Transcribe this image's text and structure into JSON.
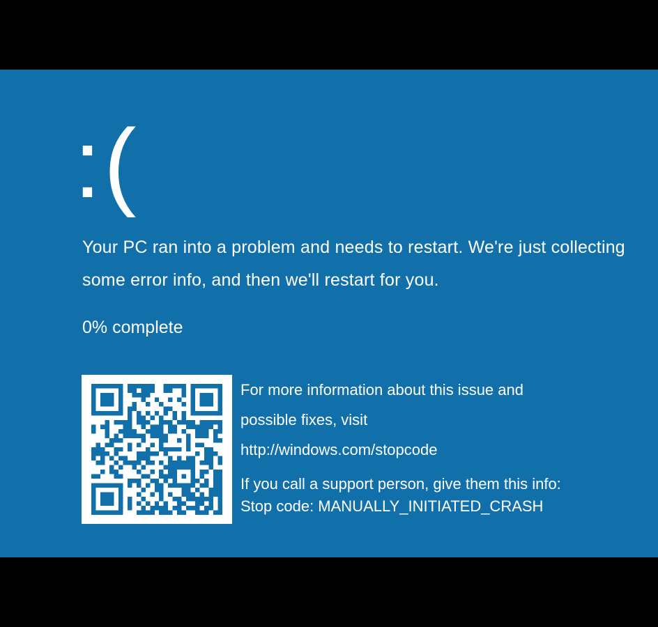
{
  "screen": {
    "background_color": "#1170aa",
    "text_color": "#ffffff",
    "sad_face": ":(",
    "message": "Your PC ran into a problem and needs to restart. We're just collecting some error info, and then we'll restart for you.",
    "progress_text": "0% complete",
    "progress_percent": 0
  },
  "info": {
    "more_info_line1": "For more information about this issue and",
    "more_info_line2": "possible fixes, visit",
    "url": "http://windows.com/stopcode",
    "support_text": "If you call a support person, give them this info:",
    "stop_code_label": "Stop code: MANUALLY_INITIATED_CRASH"
  },
  "icons": {
    "qr_code": "qr-code-icon"
  }
}
